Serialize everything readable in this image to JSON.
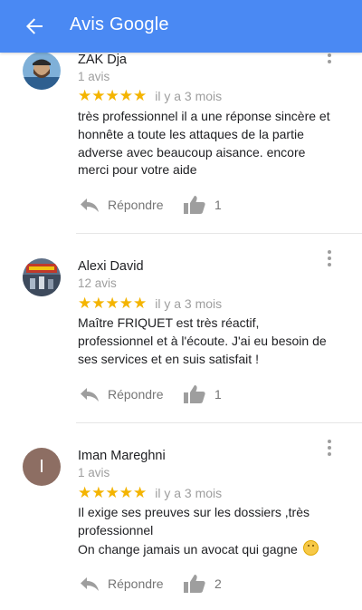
{
  "appbar": {
    "title": "Avis Google"
  },
  "reviews": [
    {
      "name": "ZAK Dja",
      "count": "1 avis",
      "stars": 5,
      "date": "il y a 3 mois",
      "text": [
        "très professionnel il a une réponse sincère et",
        "honnête a toute les attaques  de la partie",
        "adverse avec beaucoup aisance. encore",
        "merci pour votre aide"
      ],
      "reply_label": "Répondre",
      "likes": "1"
    },
    {
      "name": "Alexi David",
      "count": "12 avis",
      "stars": 5,
      "date": "il y a 3 mois",
      "text": [
        "Maître FRIQUET est très réactif,",
        "professionnel et à l'écoute. J'ai eu besoin de",
        "ses services et en suis satisfait !"
      ],
      "reply_label": "Répondre",
      "likes": "1"
    },
    {
      "name": "Iman Mareghni",
      "avatar_letter": "I",
      "count": "1 avis",
      "stars": 5,
      "date": "il y a 3 mois",
      "text": [
        "Il exige ses preuves sur les dossiers  ,très",
        "professionnel",
        "On change jamais un avocat qui gagne"
      ],
      "reply_label": "Répondre",
      "likes": "2"
    }
  ],
  "colors": {
    "appbar": "#4a89f3",
    "star": "#f4b400",
    "muted": "#9e9e9e"
  }
}
